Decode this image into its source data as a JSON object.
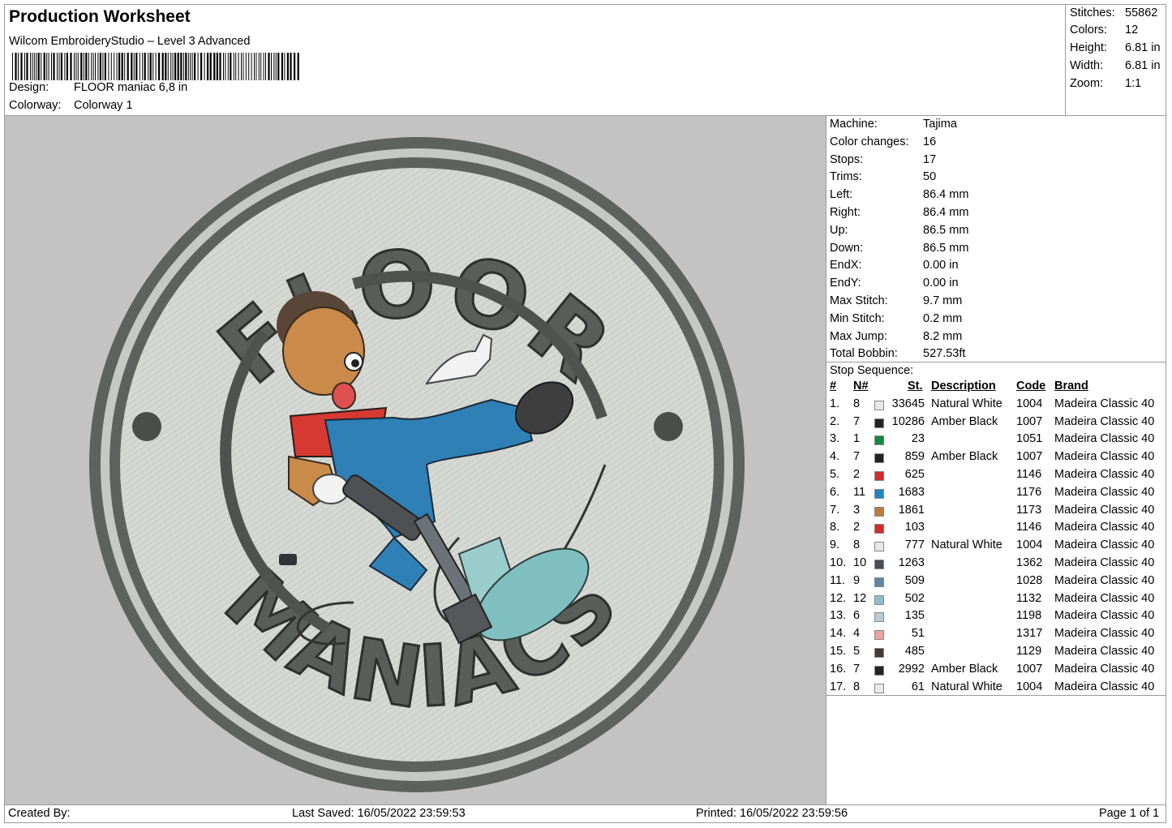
{
  "header": {
    "title": "Production Worksheet",
    "software": "Wilcom EmbroideryStudio – Level 3 Advanced",
    "design_label": "Design:",
    "design_value": "FLOOR maniac 6,8 in",
    "colorway_label": "Colorway:",
    "colorway_value": "Colorway 1"
  },
  "stats": [
    {
      "label": "Stitches:",
      "value": "55862"
    },
    {
      "label": "Colors:",
      "value": "12"
    },
    {
      "label": "Height:",
      "value": "6.81 in"
    },
    {
      "label": "Width:",
      "value": "6.81 in"
    },
    {
      "label": "Zoom:",
      "value": "1:1"
    }
  ],
  "design_art": {
    "top_text": "FLOOR",
    "bottom_text": "MANIACS"
  },
  "machine_info": [
    {
      "label": "Machine:",
      "value": "Tajima"
    },
    {
      "label": "Color changes:",
      "value": "16"
    },
    {
      "label": "Stops:",
      "value": "17"
    },
    {
      "label": "Trims:",
      "value": "50"
    },
    {
      "label": "Left:",
      "value": "86.4 mm"
    },
    {
      "label": "Right:",
      "value": "86.4 mm"
    },
    {
      "label": "Up:",
      "value": "86.5 mm"
    },
    {
      "label": "Down:",
      "value": "86.5 mm"
    },
    {
      "label": "EndX:",
      "value": "0.00 in"
    },
    {
      "label": "EndY:",
      "value": "0.00 in"
    },
    {
      "label": "Max Stitch:",
      "value": "9.7 mm"
    },
    {
      "label": "Min Stitch:",
      "value": "0.2 mm"
    },
    {
      "label": "Max Jump:",
      "value": "8.2 mm"
    },
    {
      "label": "Total Bobbin:",
      "value": "527.53ft"
    }
  ],
  "stop_sequence": {
    "title": "Stop Sequence:",
    "headers": {
      "idx": "#",
      "n": "N#",
      "st": "St.",
      "desc": "Description",
      "code": "Code",
      "brand": "Brand"
    },
    "rows": [
      {
        "idx": "1.",
        "n": "8",
        "color": "#e8e8ea",
        "st": "33645",
        "desc": "Natural White",
        "code": "1004",
        "brand": "Madeira Classic 40"
      },
      {
        "idx": "2.",
        "n": "7",
        "color": "#232323",
        "st": "10286",
        "desc": "Amber Black",
        "code": "1007",
        "brand": "Madeira Classic 40"
      },
      {
        "idx": "3.",
        "n": "1",
        "color": "#0e8a3e",
        "st": "23",
        "desc": "",
        "code": "1051",
        "brand": "Madeira Classic 40"
      },
      {
        "idx": "4.",
        "n": "7",
        "color": "#232323",
        "st": "859",
        "desc": "Amber Black",
        "code": "1007",
        "brand": "Madeira Classic 40"
      },
      {
        "idx": "5.",
        "n": "2",
        "color": "#d42a2a",
        "st": "625",
        "desc": "",
        "code": "1146",
        "brand": "Madeira Classic 40"
      },
      {
        "idx": "6.",
        "n": "11",
        "color": "#1c86c8",
        "st": "1683",
        "desc": "",
        "code": "1176",
        "brand": "Madeira Classic 40"
      },
      {
        "idx": "7.",
        "n": "3",
        "color": "#bf7b3f",
        "st": "1861",
        "desc": "",
        "code": "1173",
        "brand": "Madeira Classic 40"
      },
      {
        "idx": "8.",
        "n": "2",
        "color": "#d42a2a",
        "st": "103",
        "desc": "",
        "code": "1146",
        "brand": "Madeira Classic 40"
      },
      {
        "idx": "9.",
        "n": "8",
        "color": "#e8e8ea",
        "st": "777",
        "desc": "Natural White",
        "code": "1004",
        "brand": "Madeira Classic 40"
      },
      {
        "idx": "10.",
        "n": "10",
        "color": "#4a4c5a",
        "st": "1263",
        "desc": "",
        "code": "1362",
        "brand": "Madeira Classic 40"
      },
      {
        "idx": "11.",
        "n": "9",
        "color": "#5f86a8",
        "st": "509",
        "desc": "",
        "code": "1028",
        "brand": "Madeira Classic 40"
      },
      {
        "idx": "12.",
        "n": "12",
        "color": "#8fbcd0",
        "st": "502",
        "desc": "",
        "code": "1132",
        "brand": "Madeira Classic 40"
      },
      {
        "idx": "13.",
        "n": "6",
        "color": "#b9c9da",
        "st": "135",
        "desc": "",
        "code": "1198",
        "brand": "Madeira Classic 40"
      },
      {
        "idx": "14.",
        "n": "4",
        "color": "#e8a39c",
        "st": "51",
        "desc": "",
        "code": "1317",
        "brand": "Madeira Classic 40"
      },
      {
        "idx": "15.",
        "n": "5",
        "color": "#463833",
        "st": "485",
        "desc": "",
        "code": "1129",
        "brand": "Madeira Classic 40"
      },
      {
        "idx": "16.",
        "n": "7",
        "color": "#232323",
        "st": "2992",
        "desc": "Amber Black",
        "code": "1007",
        "brand": "Madeira Classic 40"
      },
      {
        "idx": "17.",
        "n": "8",
        "color": "#e8e8ea",
        "st": "61",
        "desc": "Natural White",
        "code": "1004",
        "brand": "Madeira Classic 40"
      }
    ]
  },
  "footer": {
    "created_by": "Created By:",
    "last_saved": "Last Saved: 16/05/2022 23:59:53",
    "printed": "Printed: 16/05/2022 23:59:56",
    "page": "Page 1 of 1"
  }
}
